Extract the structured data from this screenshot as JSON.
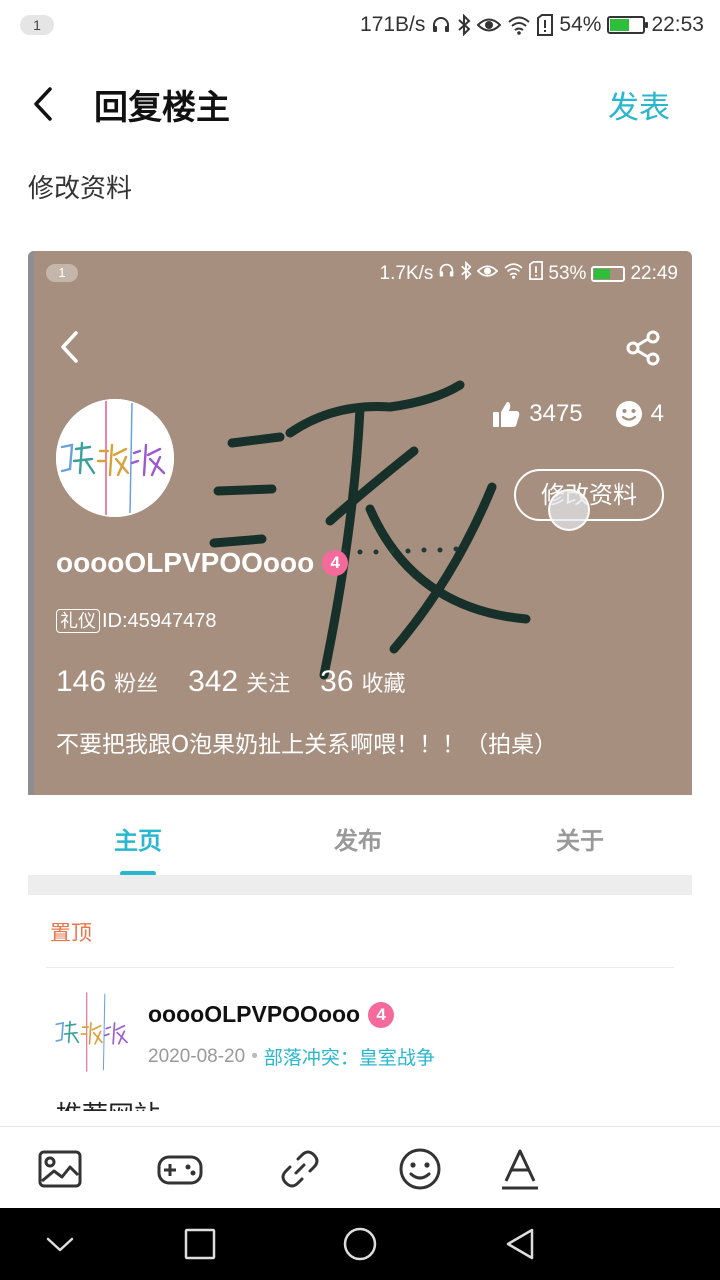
{
  "status_bar": {
    "badge": "1",
    "speed": "171B/s",
    "battery": "54%",
    "battery_level": 0.54,
    "time": "22:53"
  },
  "header": {
    "title": "回复楼主",
    "publish": "发表"
  },
  "reply_text": "修改资料",
  "screenshot": {
    "status_bar": {
      "badge": "1",
      "speed": "1.7K/s",
      "battery": "53%",
      "battery_level": 0.53,
      "time": "22:49"
    },
    "likes": "3475",
    "emoji_count": "4",
    "edit_button": "修改资料",
    "username": "ooooOLPVPOOooo",
    "level": "4",
    "id_tag": "礼仪",
    "id_text": "ID:45947478",
    "followers_num": "146",
    "followers_label": "粉丝",
    "following_num": "342",
    "following_label": "关注",
    "favorites_num": "36",
    "favorites_label": "收藏",
    "signature": "不要把我跟O泡果奶扯上关系啊喂！！！（拍桌）",
    "tabs": [
      "主页",
      "发布",
      "关于"
    ],
    "active_tab": "主页",
    "pinned_label": "置顶",
    "post": {
      "username": "ooooOLPVPOOooo",
      "level": "4",
      "date": "2020-08-20",
      "tag": "部落冲突：皇室战争",
      "title": "推荐网站"
    }
  },
  "toolbar": {
    "icons": [
      "image-icon",
      "gamepad-icon",
      "link-icon",
      "emoji-icon",
      "text-format-icon"
    ]
  },
  "nav_bar": {
    "icons": [
      "chevron-down-icon",
      "square-icon",
      "circle-icon",
      "triangle-back-icon"
    ]
  },
  "colors": {
    "accent": "#28b7cf",
    "pinned": "#e8774e",
    "level_badge": "#f56a9a",
    "profile_bg": "#a68f7f"
  }
}
